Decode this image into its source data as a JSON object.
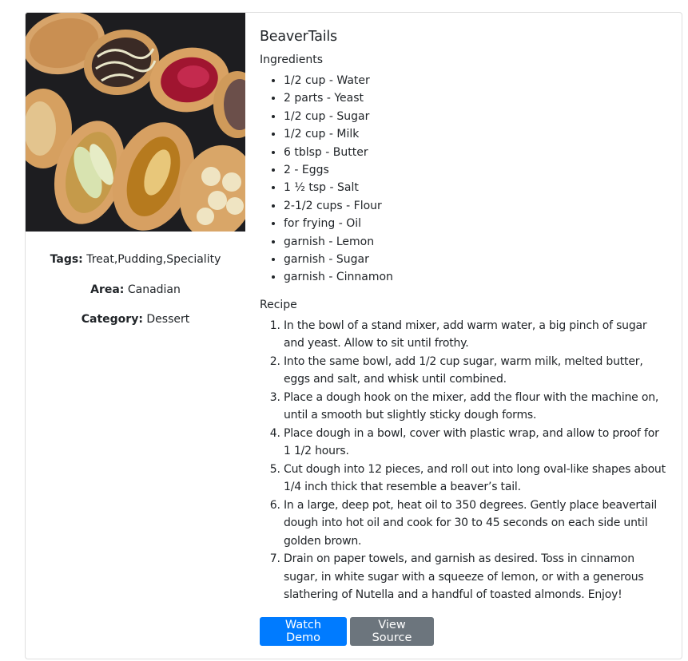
{
  "recipe": {
    "title": "BeaverTails",
    "tags_label": "Tags:",
    "tags": "Treat,Pudding,Speciality",
    "area_label": "Area:",
    "area": "Canadian",
    "category_label": "Category:",
    "category": "Dessert",
    "ingredients_heading": "Ingredients",
    "ingredients": [
      "1/2 cup - Water",
      "2 parts - Yeast",
      "1/2 cup - Sugar",
      "1/2 cup - Milk",
      "6 tblsp - Butter",
      "2 - Eggs",
      "1 ½ tsp - Salt",
      "2-1/2 cups - Flour",
      "for frying - Oil",
      "garnish - Lemon",
      "garnish - Sugar",
      "garnish - Cinnamon"
    ],
    "recipe_heading": "Recipe",
    "steps": [
      "In the bowl of a stand mixer, add warm water, a big pinch of sugar and yeast. Allow to sit until frothy.",
      "Into the same bowl, add 1/2 cup sugar, warm milk, melted butter, eggs and salt, and whisk until combined.",
      "Place a dough hook on the mixer, add the flour with the machine on, until a smooth but slightly sticky dough forms.",
      "Place dough in a bowl, cover with plastic wrap, and allow to proof for 1 1/2 hours.",
      "Cut dough into 12 pieces, and roll out into long oval-like shapes about 1/4 inch thick that resemble a beaver’s tail.",
      "In a large, deep pot, heat oil to 350 degrees. Gently place beavertail dough into hot oil and cook for 30 to 45 seconds on each side until golden brown.",
      "Drain on paper towels, and garnish as desired. Toss in cinnamon sugar, in white sugar with a squeeze of lemon, or with a generous slathering of Nutella and a handful of toasted almonds. Enjoy!"
    ]
  },
  "buttons": {
    "watch_demo": "Watch Demo",
    "view_source": "View Source"
  },
  "colors": {
    "primary": "#007bff",
    "secondary": "#6c757d"
  }
}
